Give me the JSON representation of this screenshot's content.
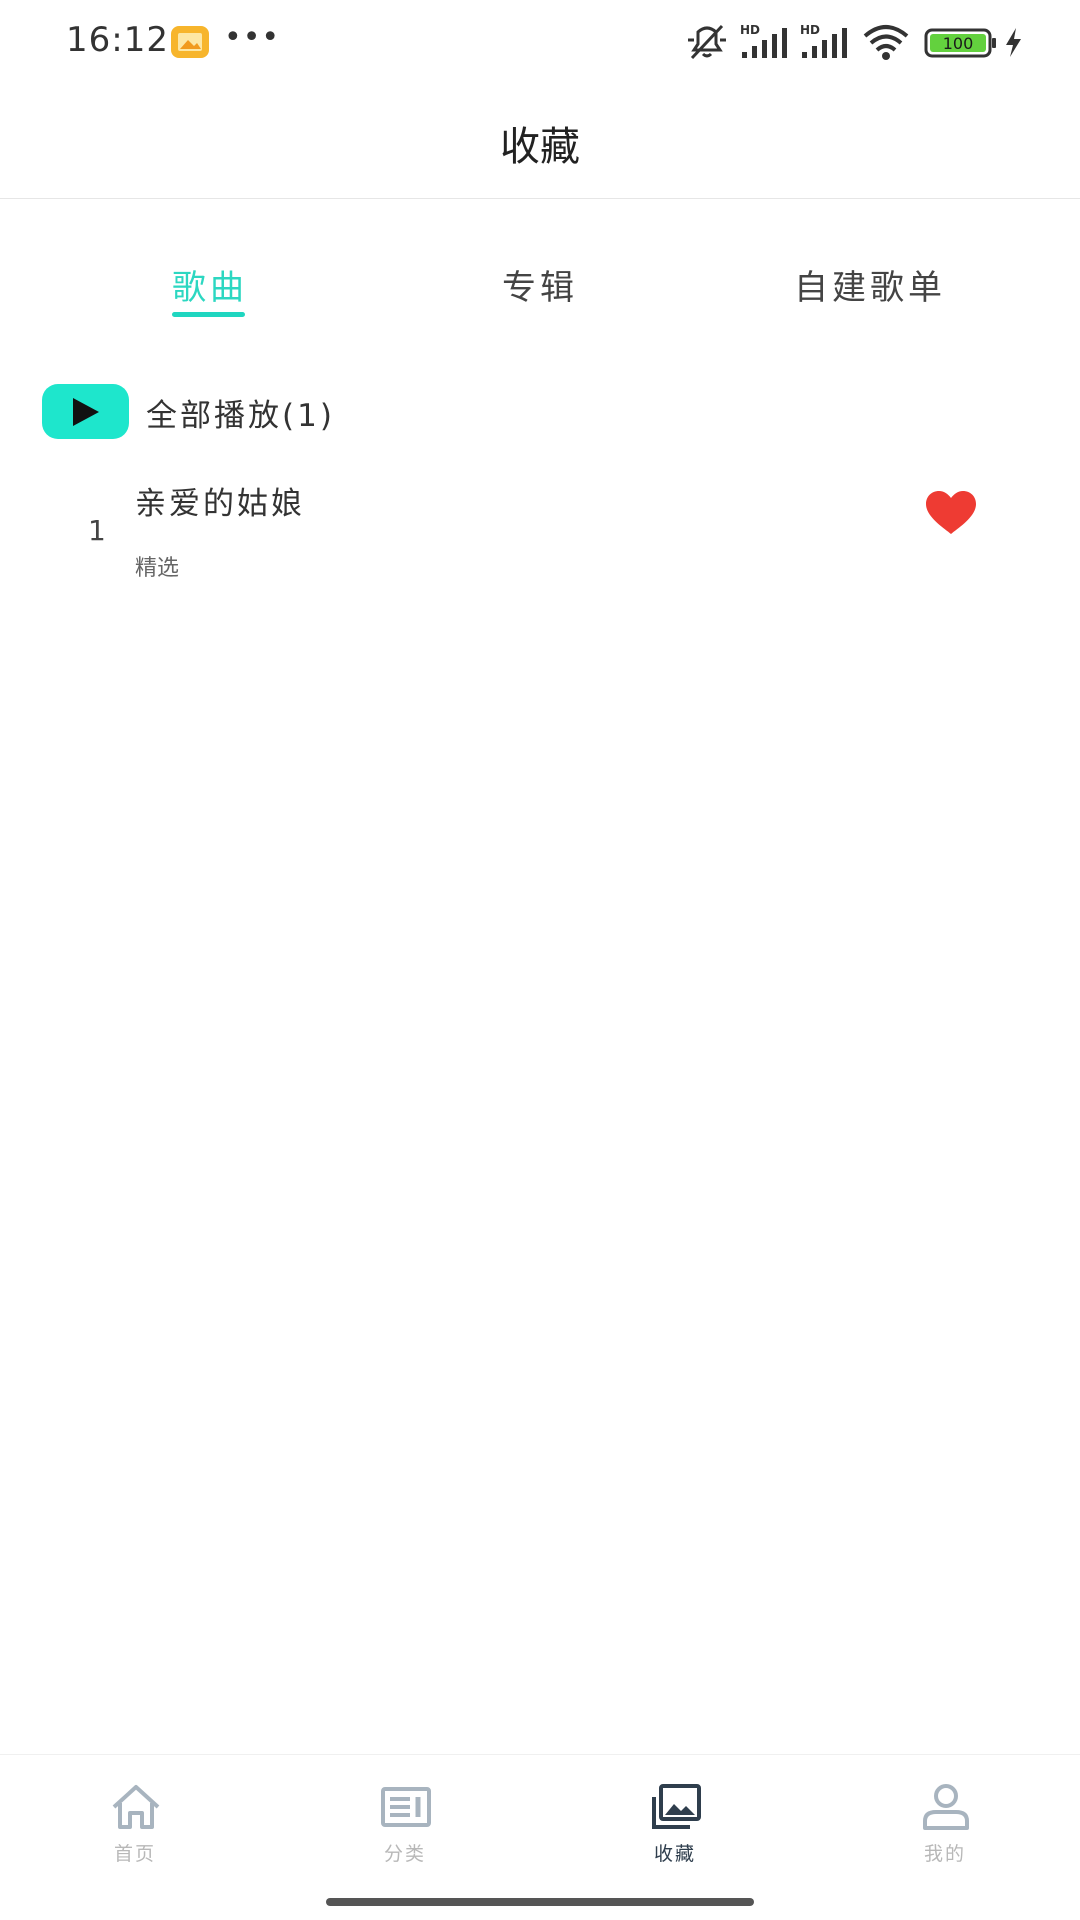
{
  "status_bar": {
    "time": "16:12",
    "more": "•••",
    "battery_level": "100",
    "icons": [
      "gallery-notification-icon",
      "mute-icon",
      "signal-hd-icon",
      "signal-hd-icon",
      "wifi-icon",
      "battery-icon",
      "charging-icon"
    ]
  },
  "header": {
    "title": "收藏"
  },
  "tabs": [
    {
      "label": "歌曲",
      "active": true
    },
    {
      "label": "专辑",
      "active": false
    },
    {
      "label": "自建歌单",
      "active": false
    }
  ],
  "play_all": {
    "label": "全部播放(1)",
    "icon": "play-icon"
  },
  "songs": [
    {
      "index": "1",
      "title": "亲爱的姑娘",
      "subtitle": "精选",
      "favorited": true
    }
  ],
  "bottom_nav": [
    {
      "label": "首页",
      "icon": "home-icon",
      "active": false
    },
    {
      "label": "分类",
      "icon": "category-icon",
      "active": false
    },
    {
      "label": "收藏",
      "icon": "collection-icon",
      "active": true
    },
    {
      "label": "我的",
      "icon": "profile-icon",
      "active": false
    }
  ],
  "colors": {
    "accent": "#1ee6cc",
    "tab_active": "#2cd7c1",
    "heart": "#ee3b33",
    "nav_active": "#2f3e4d",
    "nav_inactive": "#b8b8b8"
  }
}
